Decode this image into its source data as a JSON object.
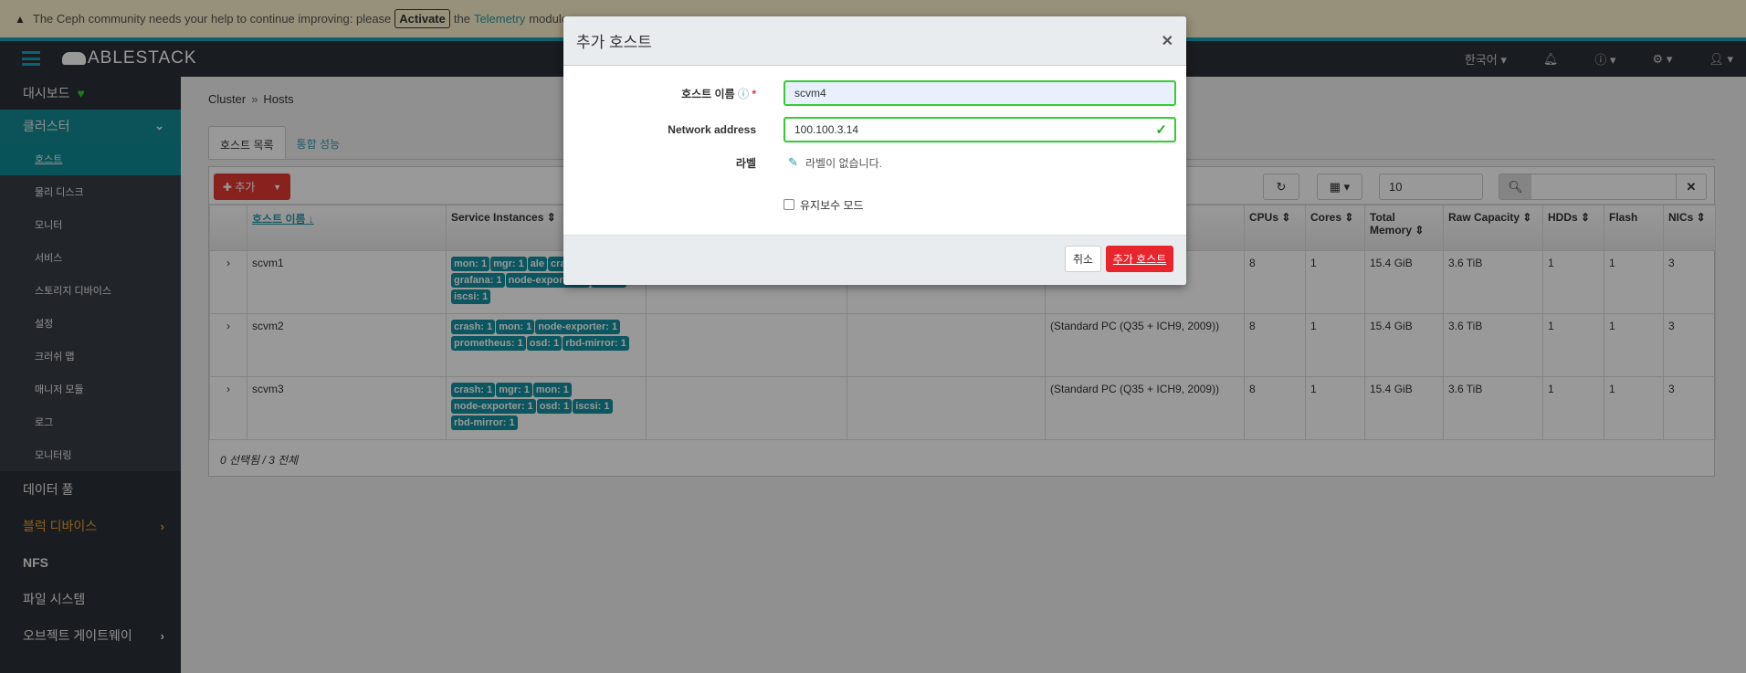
{
  "banner": {
    "text_before": "The Ceph community needs your help to continue improving: please",
    "activate": "Activate",
    "the": "the",
    "telemetry": "Telemetry",
    "text_after": "module."
  },
  "nav": {
    "brand": "ABLESTACK",
    "language": "한국어"
  },
  "sidebar": {
    "dashboard": "대시보드",
    "cluster": "클러스터",
    "cluster_items": [
      "호스트",
      "물리 디스크",
      "모니터",
      "서비스",
      "스토리지 디바이스",
      "설정",
      "크러쉬 맵",
      "매니저 모듈",
      "로그",
      "모니터링"
    ],
    "pools": "데이터 풀",
    "block": "블럭 디바이스",
    "nfs": "NFS",
    "fs": "파일 시스템",
    "rgw": "오브젝트 게이트웨이"
  },
  "breadcrumb": {
    "parent": "Cluster",
    "current": "Hosts"
  },
  "tabs": [
    "호스트 목록",
    "통합 성능"
  ],
  "toolbar": {
    "add": "추가",
    "page_size": "10",
    "search_placeholder": ""
  },
  "table": {
    "headers": [
      "호스트 이름",
      "Service Instances",
      "",
      "",
      "",
      "CPUs",
      "Cores",
      "Total Memory",
      "Raw Capacity",
      "HDDs",
      "Flash",
      "NICs"
    ],
    "rows": [
      {
        "host": "scvm1",
        "services": [
          "mon: 1",
          "mgr: 1",
          "ale",
          "crash: 1",
          "grafana: 1",
          "node-exporter: 1",
          "osd: 1",
          "iscsi: 1"
        ],
        "model": "2009))",
        "cpus": "8",
        "cores": "1",
        "mem": "15.4 GiB",
        "raw": "3.6 TiB",
        "hdds": "1",
        "flash": "1",
        "nics": "3"
      },
      {
        "host": "scvm2",
        "services": [
          "crash: 1",
          "mon: 1",
          "node-exporter: 1",
          "prometheus: 1",
          "osd: 1",
          "rbd-mirror: 1"
        ],
        "model": "(Standard PC (Q35 + ICH9, 2009))",
        "cpus": "8",
        "cores": "1",
        "mem": "15.4 GiB",
        "raw": "3.6 TiB",
        "hdds": "1",
        "flash": "1",
        "nics": "3"
      },
      {
        "host": "scvm3",
        "services": [
          "crash: 1",
          "mgr: 1",
          "mon: 1",
          "node-exporter: 1",
          "osd: 1",
          "iscsi: 1",
          "rbd-mirror: 1"
        ],
        "model": "(Standard PC (Q35 + ICH9, 2009))",
        "cpus": "8",
        "cores": "1",
        "mem": "15.4 GiB",
        "raw": "3.6 TiB",
        "hdds": "1",
        "flash": "1",
        "nics": "3"
      }
    ],
    "footer": "0 선택됨 / 3 전체"
  },
  "modal": {
    "title": "추가 호스트",
    "hostname_label": "호스트 이름",
    "hostname_value": "scvm4",
    "network_label": "Network address",
    "network_value": "100.100.3.14",
    "labels_label": "라벨",
    "labels_empty": "라벨이 없습니다.",
    "maintenance": "유지보수 모드",
    "cancel": "취소",
    "submit": "추가 호스트"
  }
}
